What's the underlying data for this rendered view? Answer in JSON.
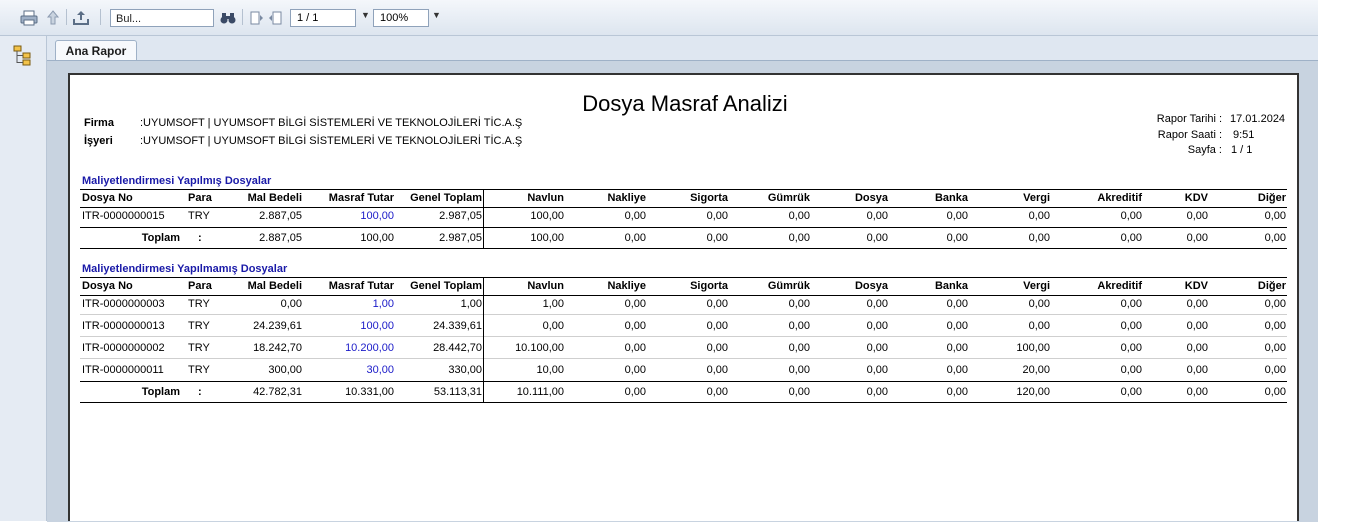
{
  "toolbar": {
    "find_placeholder": "Bul...",
    "page_indicator": "1 / 1",
    "zoom": "100%",
    "dropdown_glyph": "▼"
  },
  "tab": {
    "label": "Ana Rapor"
  },
  "report": {
    "title": "Dosya Masraf Analizi",
    "firma_label": "Firma",
    "firma_value": ":UYUMSOFT | UYUMSOFT BİLGİ SİSTEMLERİ VE TEKNOLOJİLERİ TİC.A.Ş",
    "isyeri_label": "İşyeri",
    "isyeri_value": ":UYUMSOFT | UYUMSOFT BİLGİ SİSTEMLERİ VE TEKNOLOJİLERİ TİC.A.Ş",
    "rapor_tarihi_label": "Rapor Tarihi  :",
    "rapor_tarihi": "17.01.2024",
    "rapor_saati_label": "Rapor Saati  :",
    "rapor_saati": "9:51",
    "sayfa_label": "Sayfa  :",
    "sayfa": "1 / 1",
    "columns": [
      "Dosya No",
      "Para",
      "Mal Bedeli",
      "Masraf Tutar",
      "Genel Toplam",
      "Navlun",
      "Nakliye",
      "Sigorta",
      "Gümrük",
      "Dosya",
      "Banka",
      "Vergi",
      "Akreditif",
      "KDV",
      "Diğer"
    ],
    "total_label": "Toplam",
    "total_colon": ":",
    "section1": {
      "title": "Maliyetlendirmesi Yapılmış Dosyalar",
      "rows": [
        [
          "ITR-0000000015",
          "TRY",
          "2.887,05",
          "100,00",
          "2.987,05",
          "100,00",
          "0,00",
          "0,00",
          "0,00",
          "0,00",
          "0,00",
          "0,00",
          "0,00",
          "0,00",
          "0,00"
        ]
      ],
      "total": [
        "2.887,05",
        "100,00",
        "2.987,05",
        "100,00",
        "0,00",
        "0,00",
        "0,00",
        "0,00",
        "0,00",
        "0,00",
        "0,00",
        "0,00",
        "0,00"
      ]
    },
    "section2": {
      "title": "Maliyetlendirmesi Yapılmamış Dosyalar",
      "rows": [
        [
          "ITR-0000000003",
          "TRY",
          "0,00",
          "1,00",
          "1,00",
          "1,00",
          "0,00",
          "0,00",
          "0,00",
          "0,00",
          "0,00",
          "0,00",
          "0,00",
          "0,00",
          "0,00"
        ],
        [
          "ITR-0000000013",
          "TRY",
          "24.239,61",
          "100,00",
          "24.339,61",
          "0,00",
          "0,00",
          "0,00",
          "0,00",
          "0,00",
          "0,00",
          "0,00",
          "0,00",
          "0,00",
          "0,00"
        ],
        [
          "ITR-0000000002",
          "TRY",
          "18.242,70",
          "10.200,00",
          "28.442,70",
          "10.100,00",
          "0,00",
          "0,00",
          "0,00",
          "0,00",
          "0,00",
          "100,00",
          "0,00",
          "0,00",
          "0,00"
        ],
        [
          "ITR-0000000011",
          "TRY",
          "300,00",
          "30,00",
          "330,00",
          "10,00",
          "0,00",
          "0,00",
          "0,00",
          "0,00",
          "0,00",
          "20,00",
          "0,00",
          "0,00",
          "0,00"
        ]
      ],
      "total": [
        "42.782,31",
        "10.331,00",
        "53.113,31",
        "10.111,00",
        "0,00",
        "0,00",
        "0,00",
        "0,00",
        "0,00",
        "120,00",
        "0,00",
        "0,00",
        "0,00"
      ]
    }
  }
}
